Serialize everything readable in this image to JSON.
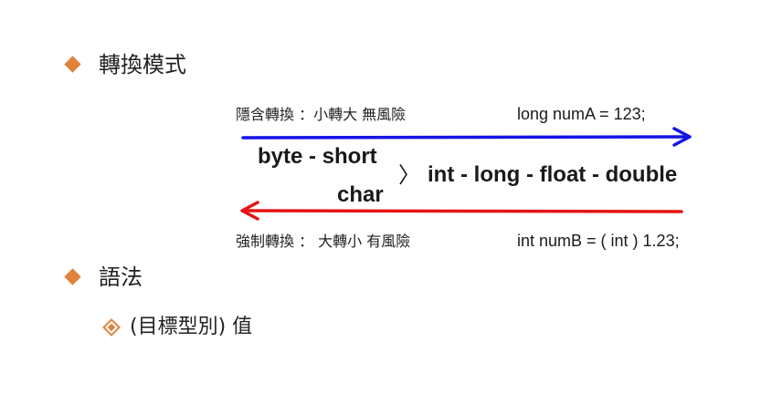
{
  "bullets": {
    "conversion_modes": "轉換模式",
    "syntax": "語法"
  },
  "implicit": {
    "label": "隱含轉換 ：小轉大 無風險",
    "example": "long numA = 123;",
    "arrow_color": "#1414e6",
    "direction": "right"
  },
  "explicit": {
    "label": "強制轉換 ： 大轉小 有風險",
    "example": "int numB = ( int ) 1.23;",
    "arrow_color": "#e61414",
    "direction": "left"
  },
  "types": {
    "upper": "byte - short",
    "lower": "char",
    "greater_than": "〉",
    "right": "int - long - float - double"
  },
  "syntax_item": "(目標型別) 值",
  "colors": {
    "bullet_accent": "#e0823a"
  }
}
